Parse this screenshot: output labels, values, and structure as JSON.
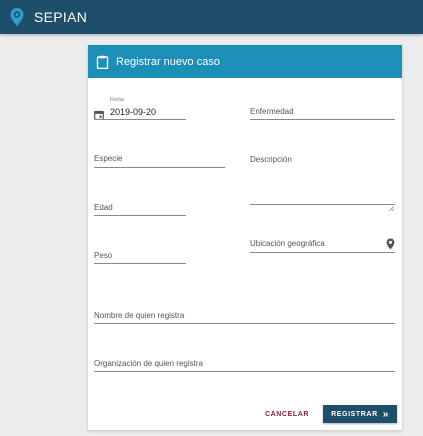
{
  "app": {
    "title": "SEPIAN",
    "logo_icon": "location-pin-logo-icon"
  },
  "form": {
    "title": "Registrar nuevo caso",
    "header_icon": "clipboard-icon",
    "accent_color": "#1b8fb8",
    "fields": {
      "fecha": {
        "label": "Fecha",
        "value": "2019-09-20",
        "icon": "calendar-icon"
      },
      "enfermedad": {
        "label": "Enfermedad",
        "value": ""
      },
      "especie": {
        "label": "Especie",
        "value": ""
      },
      "descripcion": {
        "label": "Descripción",
        "value": ""
      },
      "edad": {
        "label": "Edad",
        "value": ""
      },
      "peso": {
        "label": "Peso",
        "value": ""
      },
      "ubicacion": {
        "label": "Ubicación geográfica",
        "value": "",
        "icon": "location-pin-icon"
      },
      "nombre": {
        "label": "Nombre de quien registra",
        "value": ""
      },
      "organizacion": {
        "label": "Organización de quien registra",
        "value": ""
      }
    },
    "actions": {
      "cancel_label": "CANCELAR",
      "register_label": "REGISTRAR",
      "register_icon_glyph": "»"
    }
  },
  "colors": {
    "appbar": "#1f4e6b",
    "cancel_text": "#8b1e3f",
    "register_button": "#1f4e6b"
  }
}
